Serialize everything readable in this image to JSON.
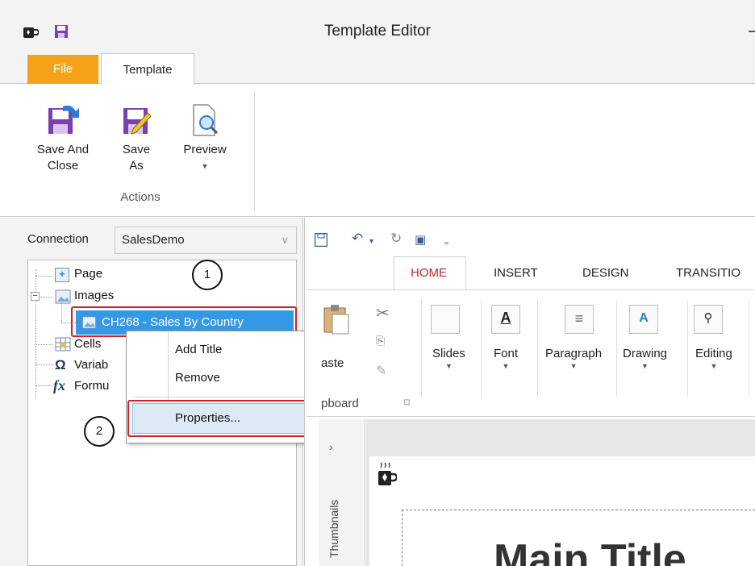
{
  "window": {
    "title": "Template Editor"
  },
  "ribbon_tabs": {
    "file": "File",
    "template": "Template"
  },
  "actions": {
    "save_and_close_l1": "Save And",
    "save_and_close_l2": "Close",
    "save_as_l1": "Save",
    "save_as_l2": "As",
    "preview": "Preview",
    "group_label": "Actions"
  },
  "connection": {
    "label": "Connection",
    "value": "SalesDemo"
  },
  "tree": {
    "page": "Page",
    "images": "Images",
    "selected_image": "CH268 - Sales By Country",
    "cells": "Cells",
    "variables": "Variab",
    "formulas": "Formu"
  },
  "context_menu": {
    "add_title": "Add Title",
    "remove": "Remove",
    "properties": "Properties..."
  },
  "callouts": {
    "one": "1",
    "two": "2"
  },
  "powerpoint": {
    "tabs": [
      "HOME",
      "INSERT",
      "DESIGN",
      "TRANSITIO"
    ],
    "groups": [
      "Slides",
      "Font",
      "Paragraph",
      "Drawing",
      "Editing"
    ],
    "paste_fragment": "aste",
    "clipboard_fragment": "pboard",
    "thumbnails_label": "Thumbnails",
    "slide_title": "Main Title"
  },
  "colors": {
    "file_tab": "#f5a21a",
    "selection": "#3399e6",
    "highlight_outline": "#d61f26",
    "home_tab": "#c1272d"
  }
}
